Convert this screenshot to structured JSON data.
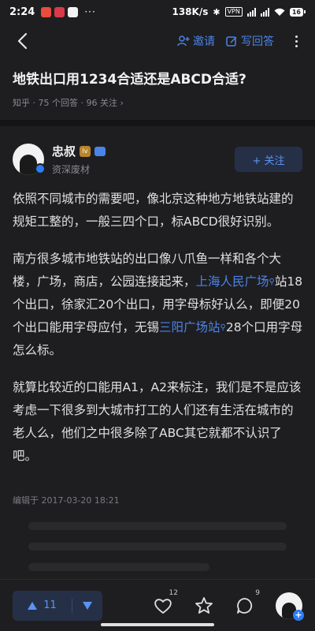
{
  "status_bar": {
    "time": "2:24",
    "more": "···",
    "speed": "138K/s",
    "vpn": "VPN",
    "battery": "16"
  },
  "topbar": {
    "invite_label": "邀请",
    "write_answer_label": "写回答"
  },
  "question": {
    "title": "地铁出口用1234合适还是ABCD合适?",
    "meta": "知乎 · 75 个回答 · 96 关注 ›"
  },
  "author": {
    "name": "忠叔",
    "desc": "资深废材",
    "level": "lv",
    "follow_label": "+ 关注"
  },
  "answer": {
    "p1": "依照不同城市的需要吧，像北京这种地方地铁站建的规矩工整的，一般三四个口，标ABCD很好识别。",
    "p2_a": "南方很多城市地铁站的出口像八爪鱼一样和各个大楼，广场，商店，公园连接起来，",
    "p2_link1": "上海人民广场",
    "p2_b": "站18个出口，徐家汇20个出口，用字母标好认么，即便20个出口能用字母应付，无锡",
    "p2_link2": "三阳广场站",
    "p2_c": "28个口用字母怎么标。",
    "p3": "就算比较近的口能用A1，A2来标注，我们是不是应该考虑一下很多到大城市打工的人们还有生活在城市的老人么，他们之中很多除了ABC其它就都不认识了吧。",
    "edit_time": "编辑于 2017-03-20 18:21"
  },
  "bottom_bar": {
    "upvotes": "11",
    "likes_count": "12",
    "comments_count": "9"
  },
  "colors": {
    "background": "#1e1e21",
    "accent": "#4b84e8",
    "button_bg": "#253047"
  }
}
